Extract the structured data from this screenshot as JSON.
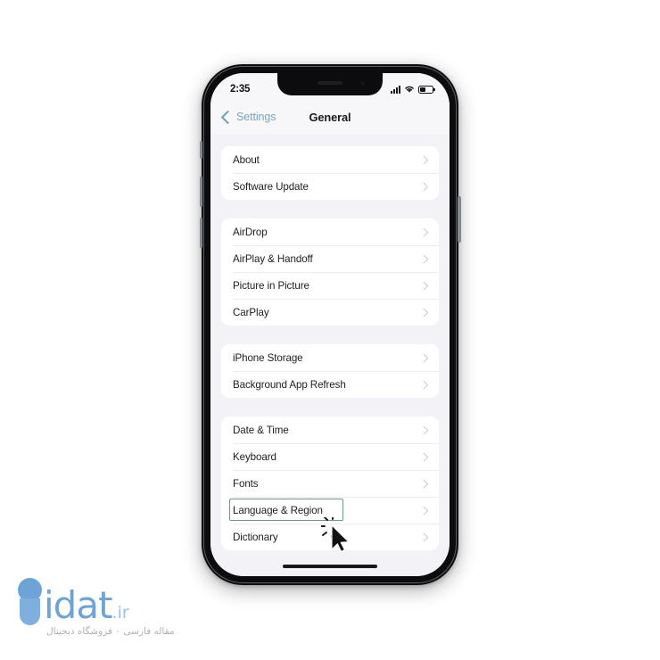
{
  "device": {
    "status_bar": {
      "time": "2:35",
      "signal_icon": "cellular-signal-icon",
      "wifi_icon": "wifi-icon",
      "battery_icon": "battery-icon",
      "battery_level_percent": 40
    },
    "home_indicator": "home-indicator"
  },
  "nav": {
    "back_label": "Settings",
    "back_icon": "chevron-left-icon",
    "title": "General"
  },
  "groups": [
    {
      "id": "group-info",
      "rows": [
        {
          "label": "About",
          "name": "row-about"
        },
        {
          "label": "Software Update",
          "name": "row-software-update"
        }
      ]
    },
    {
      "id": "group-connectivity",
      "rows": [
        {
          "label": "AirDrop",
          "name": "row-airdrop"
        },
        {
          "label": "AirPlay & Handoff",
          "name": "row-airplay-handoff"
        },
        {
          "label": "Picture in Picture",
          "name": "row-picture-in-picture"
        },
        {
          "label": "CarPlay",
          "name": "row-carplay"
        }
      ]
    },
    {
      "id": "group-storage",
      "rows": [
        {
          "label": "iPhone Storage",
          "name": "row-iphone-storage"
        },
        {
          "label": "Background App Refresh",
          "name": "row-background-app-refresh"
        }
      ]
    },
    {
      "id": "group-preferences",
      "rows": [
        {
          "label": "Date & Time",
          "name": "row-date-time"
        },
        {
          "label": "Keyboard",
          "name": "row-keyboard"
        },
        {
          "label": "Fonts",
          "name": "row-fonts"
        },
        {
          "label": "Language & Region",
          "name": "row-language-region",
          "highlighted": true
        },
        {
          "label": "Dictionary",
          "name": "row-dictionary"
        }
      ]
    }
  ],
  "annotation": {
    "highlight_target": "Language & Region",
    "highlight_color": "#6f9a88",
    "cursor_icon": "mouse-pointer-click-icon"
  },
  "watermark": {
    "brand_g": "g",
    "brand_rest": "idat",
    "tld": ".ir",
    "subtitle": "مقاله فارسی ۰ فروشگاه دیجیتال",
    "color": "#6ea3d6"
  },
  "theme": {
    "page_background": "#ffffff",
    "screen_background": "#f2f2f7",
    "card_background": "#ffffff",
    "nav_tint": "#7aa7bd",
    "text_primary": "#1d1d21",
    "chevron_color": "#c9c9ce"
  }
}
